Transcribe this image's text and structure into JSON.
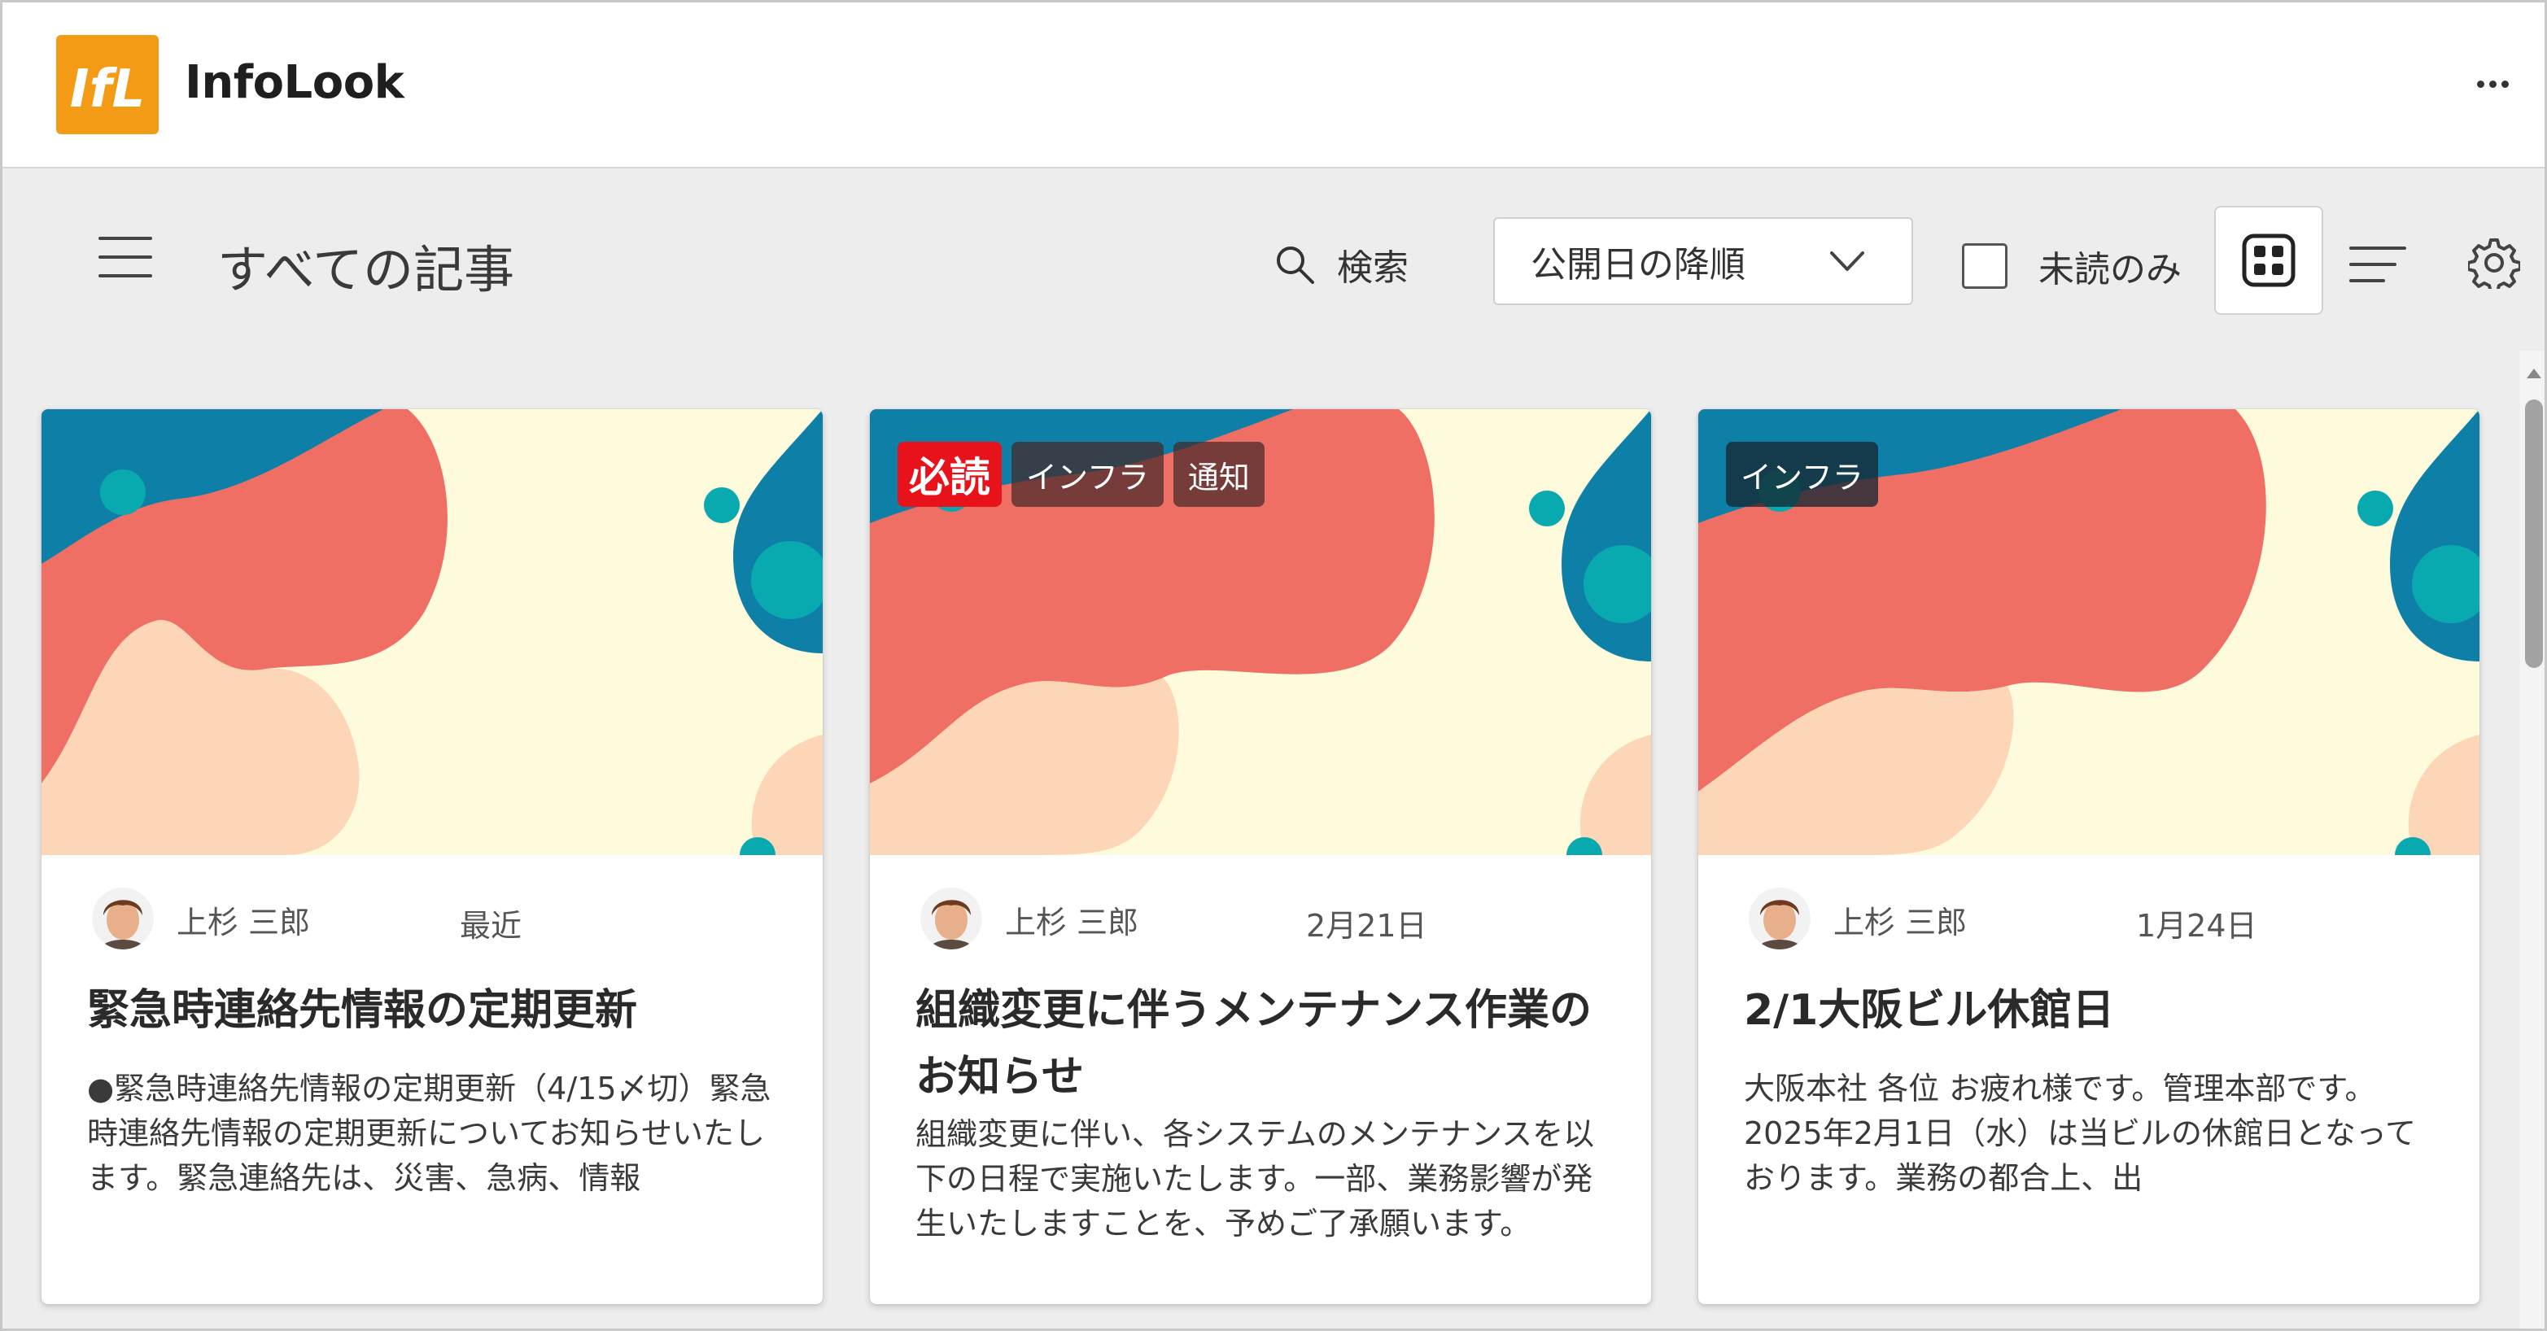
{
  "app": {
    "title": "InfoLook",
    "logo_text": "IfL"
  },
  "toolbar": {
    "page_title": "すべての記事",
    "search_label": "検索",
    "sort_value": "公開日の降順",
    "unread_label": "未読のみ"
  },
  "icons": {
    "menu": "hamburger-icon",
    "search": "search-icon",
    "sort": "chevron-down-icon",
    "grid": "grid-view-icon",
    "list": "list-view-icon",
    "settings": "gear-icon",
    "more": "more-icon"
  },
  "colors": {
    "coral": "#ef6f64",
    "peach": "#fcd6b6",
    "cream": "#fdfbdc",
    "blue": "#0e7fa6",
    "teal": "#09a9b0",
    "must_red": "#e8121b",
    "logo_orange": "#f39b14"
  },
  "articles": [
    {
      "tags": [],
      "author": "上杉 三郎",
      "date": "最近",
      "title": "緊急時連絡先情報の定期更新",
      "excerpt": "●緊急時連絡先情報の定期更新（4/15〆切）緊急時連絡先情報の定期更新についてお知らせいたします。緊急連絡先は、災害、急病、情報"
    },
    {
      "tags": [
        "必読",
        "インフラ",
        "通知"
      ],
      "author": "上杉 三郎",
      "date": "2月21日",
      "title": "組織変更に伴うメンテナンス作業のお知らせ",
      "excerpt": "組織変更に伴い、各システムのメンテナンスを以下の日程で実施いたします。一部、業務影響が発生いたしますことを、予めご了承願います。"
    },
    {
      "tags": [
        "インフラ"
      ],
      "author": "上杉 三郎",
      "date": "1月24日",
      "title": "2/1大阪ビル休館日",
      "excerpt": "大阪本社 各位 お疲れ様です。管理本部です。2025年2月1日（水）は当ビルの休館日となっております。業務の都合上、出"
    }
  ]
}
